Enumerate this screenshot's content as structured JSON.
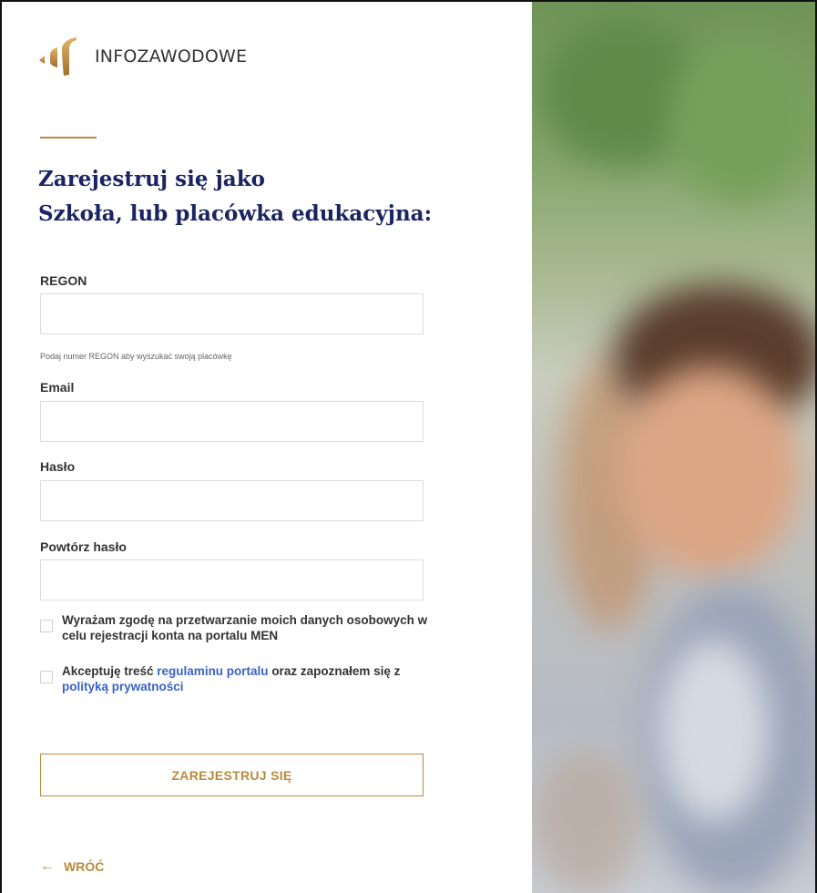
{
  "brand": {
    "name": "INFOZAWODOWE",
    "accent": "#b9893c",
    "heading_color": "#1b2463",
    "link_color": "#3a63c9"
  },
  "heading": {
    "line1": "Zarejestruj się jako",
    "line2": "Szkoła, lub placówka edukacyjna:"
  },
  "form": {
    "regon": {
      "label": "REGON",
      "value": "",
      "hint": "Podaj numer REGON aby wyszukać swoją placówkę"
    },
    "email": {
      "label": "Email",
      "value": ""
    },
    "password": {
      "label": "Hasło",
      "value": ""
    },
    "password_repeat": {
      "label": "Powtórz hasło",
      "value": ""
    },
    "consent": {
      "text": "Wyrażam zgodę na przetwarzanie moich danych osobowych w celu rejestracji konta na portalu MEN",
      "checked": false
    },
    "terms": {
      "text_before": "Akceptuję treść ",
      "link1": "regulaminu portalu",
      "text_middle": " oraz zapoznałem się z ",
      "link2": "polityką prywatności",
      "checked": false
    },
    "submit_label": "ZAREJESTRUJ SIĘ"
  },
  "back": {
    "icon": "arrow-left-icon",
    "label": "WRÓĆ"
  },
  "photo": {
    "description_icon": "students-photo"
  }
}
